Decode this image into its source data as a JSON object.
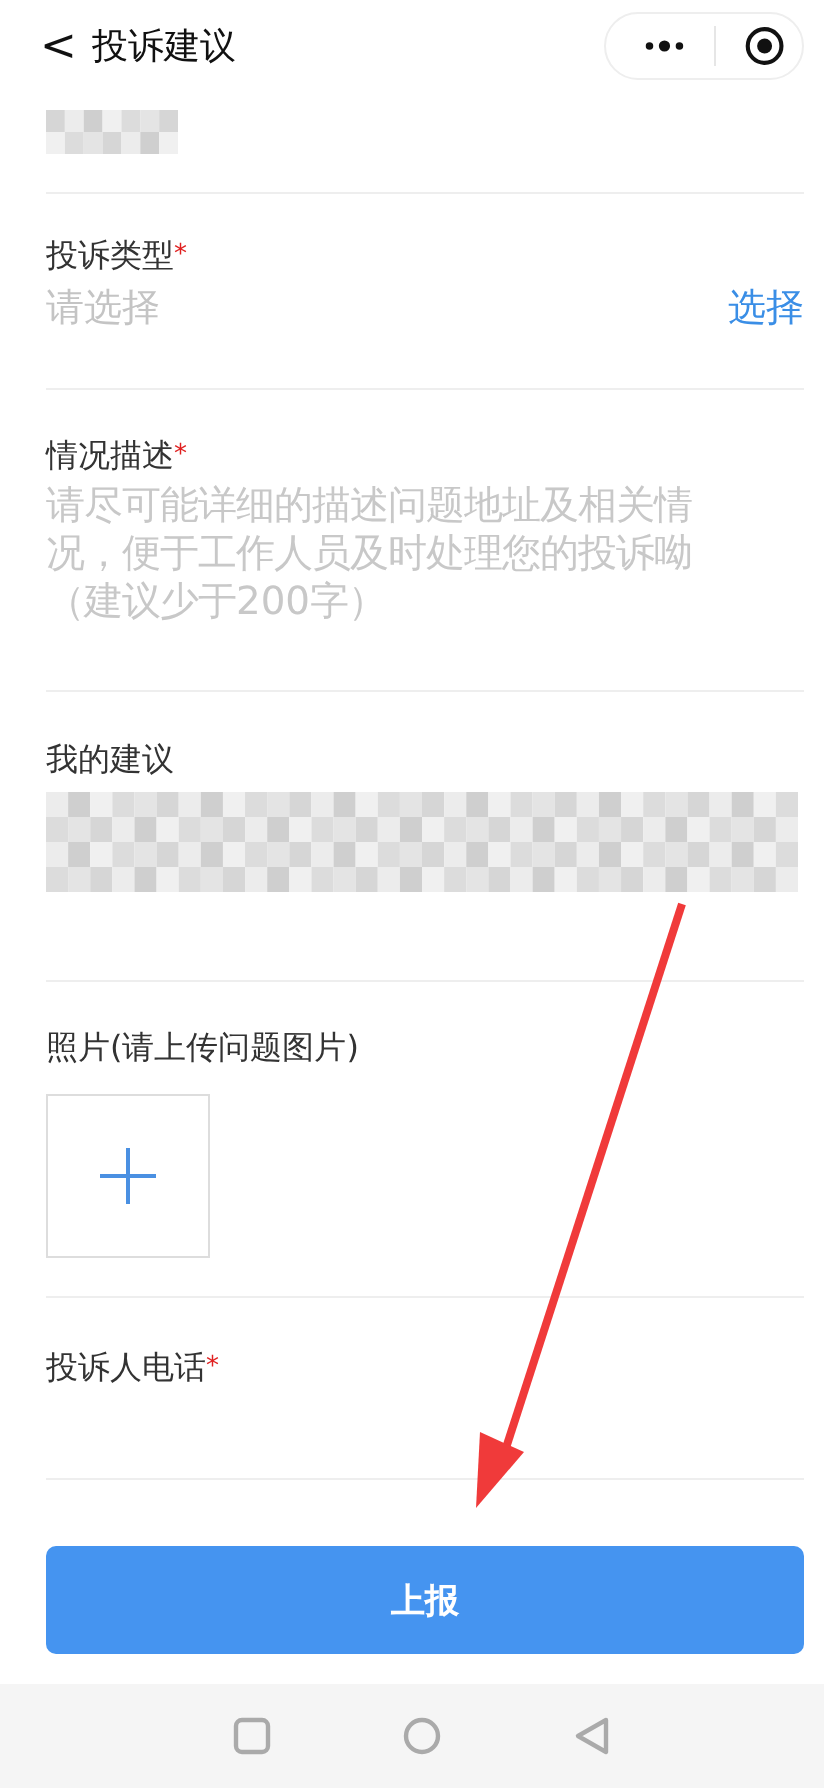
{
  "nav": {
    "back": "<",
    "title": "投诉建议"
  },
  "fields": [
    {
      "kind": "blurred"
    },
    {
      "kind": "select",
      "label": "投诉类型",
      "mark": "*",
      "placeholder": "请选择",
      "action": "选择"
    },
    {
      "kind": "textarea",
      "label": "情况描述",
      "mark": "*",
      "placeholder": "请尽可能详细的描述问题地址及相关情况，便于工作人员及时处理您的投诉呦（建议少于200字）"
    },
    {
      "kind": "blurred_text",
      "label": "我的建议"
    },
    {
      "kind": "photo",
      "label": "照片(请上传问题图片)"
    },
    {
      "kind": "phone",
      "label": "投诉人电话",
      "mark": "*"
    }
  ],
  "submit": "上报"
}
